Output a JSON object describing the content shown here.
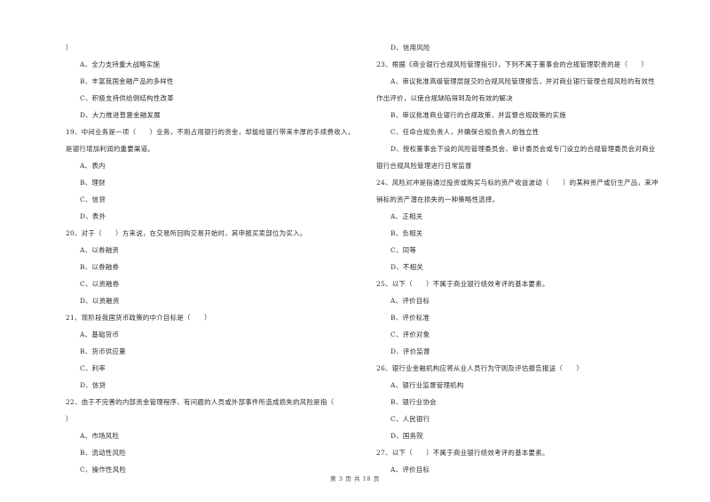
{
  "document": {
    "left_column": [
      {
        "type": "cont",
        "text": "）"
      },
      {
        "type": "opt",
        "text": "A、全力支持重大战略实施"
      },
      {
        "type": "opt",
        "text": "B、丰富我国金融产品的多样性"
      },
      {
        "type": "opt",
        "text": "C、积极支持供给侧结构性改革"
      },
      {
        "type": "opt",
        "text": "D、大力推进普惠金融发展"
      },
      {
        "type": "q",
        "text": "19、中间业务是一项（　　）业务，不用占用银行的资金，却能给银行带来丰厚的手续费收入，"
      },
      {
        "type": "cont",
        "text": "是银行增加利润的重要渠道。"
      },
      {
        "type": "opt",
        "text": "A、表内"
      },
      {
        "type": "opt",
        "text": "B、理财"
      },
      {
        "type": "opt",
        "text": "C、信贷"
      },
      {
        "type": "opt",
        "text": "D、表外"
      },
      {
        "type": "q",
        "text": "20、对于（　　）方来说，在交易所回购交易开始时，其申报买卖部位为买入。"
      },
      {
        "type": "opt",
        "text": "A、以券融资"
      },
      {
        "type": "opt",
        "text": "B、以券融券"
      },
      {
        "type": "opt",
        "text": "C、以资融券"
      },
      {
        "type": "opt",
        "text": "D、以资融资"
      },
      {
        "type": "q",
        "text": "21、现阶段我国货币政策的中介目标是（　　）"
      },
      {
        "type": "opt",
        "text": "A、基础货币"
      },
      {
        "type": "opt",
        "text": "B、货币供应量"
      },
      {
        "type": "opt",
        "text": "C、利率"
      },
      {
        "type": "opt",
        "text": "D、信贷"
      },
      {
        "type": "q",
        "text": "22、由于不完善的内部资金管理程序、有问题的人员或外部事件所造成损失的风险是指（"
      },
      {
        "type": "cont",
        "text": "）"
      },
      {
        "type": "opt",
        "text": "A、市场风险"
      },
      {
        "type": "opt",
        "text": "B、流动性风险"
      },
      {
        "type": "opt",
        "text": "C、操作性风险"
      }
    ],
    "right_column": [
      {
        "type": "opt",
        "text": "D、信用风险"
      },
      {
        "type": "q",
        "text": "23、根据《商业银行合规风险管理指引》，下列不属于董事会的合规管理职责的是（　　）"
      },
      {
        "type": "opt",
        "text": "A、审议批准高级管理层提交的合规风险管理报告，并对商业银行管理合规风险的有效性"
      },
      {
        "type": "cont",
        "text": "作出评价，以使合规缺陷得到及时有效的解决"
      },
      {
        "type": "opt",
        "text": "B、审议批准商业银行的合规政策，并监督合规政策的实施"
      },
      {
        "type": "opt",
        "text": "C、任命合规负责人，并确保合规负责人的独立性"
      },
      {
        "type": "opt",
        "text": "D、授权董事会下设的风险管理委员会、审计委员会或专门设立的合规管理委员会对商业"
      },
      {
        "type": "cont",
        "text": "银行合规风险管理进行日常监督"
      },
      {
        "type": "q",
        "text": "24、风险对冲是指通过投资或购买与标的资产收益波动（　　）的某种资产或衍生产品，来冲"
      },
      {
        "type": "cont",
        "text": "销标的资产潜在损失的一种策略性选择。"
      },
      {
        "type": "opt",
        "text": "A、正相关"
      },
      {
        "type": "opt",
        "text": "B、负相关"
      },
      {
        "type": "opt",
        "text": "C、同等"
      },
      {
        "type": "opt",
        "text": "D、不相关"
      },
      {
        "type": "q",
        "text": "25、以下（　　）不属于商业银行绩效考评的基本要素。"
      },
      {
        "type": "opt",
        "text": "A、评价目标"
      },
      {
        "type": "opt",
        "text": "B、评价标准"
      },
      {
        "type": "opt",
        "text": "C、评价对象"
      },
      {
        "type": "opt",
        "text": "D、评价监督"
      },
      {
        "type": "q",
        "text": "26、银行业金融机构应将从业人员行为守则及评估报告报送（　　）"
      },
      {
        "type": "opt",
        "text": "A、银行业监督管理机构"
      },
      {
        "type": "opt",
        "text": "B、银行业协会"
      },
      {
        "type": "opt",
        "text": "C、人民银行"
      },
      {
        "type": "opt",
        "text": "D、国务院"
      },
      {
        "type": "q",
        "text": "27、以下（　　）不属于商业银行绩效考评的基本要素。"
      },
      {
        "type": "opt",
        "text": "A、评价目标"
      }
    ],
    "footer": "第 3 页 共 18 页"
  }
}
